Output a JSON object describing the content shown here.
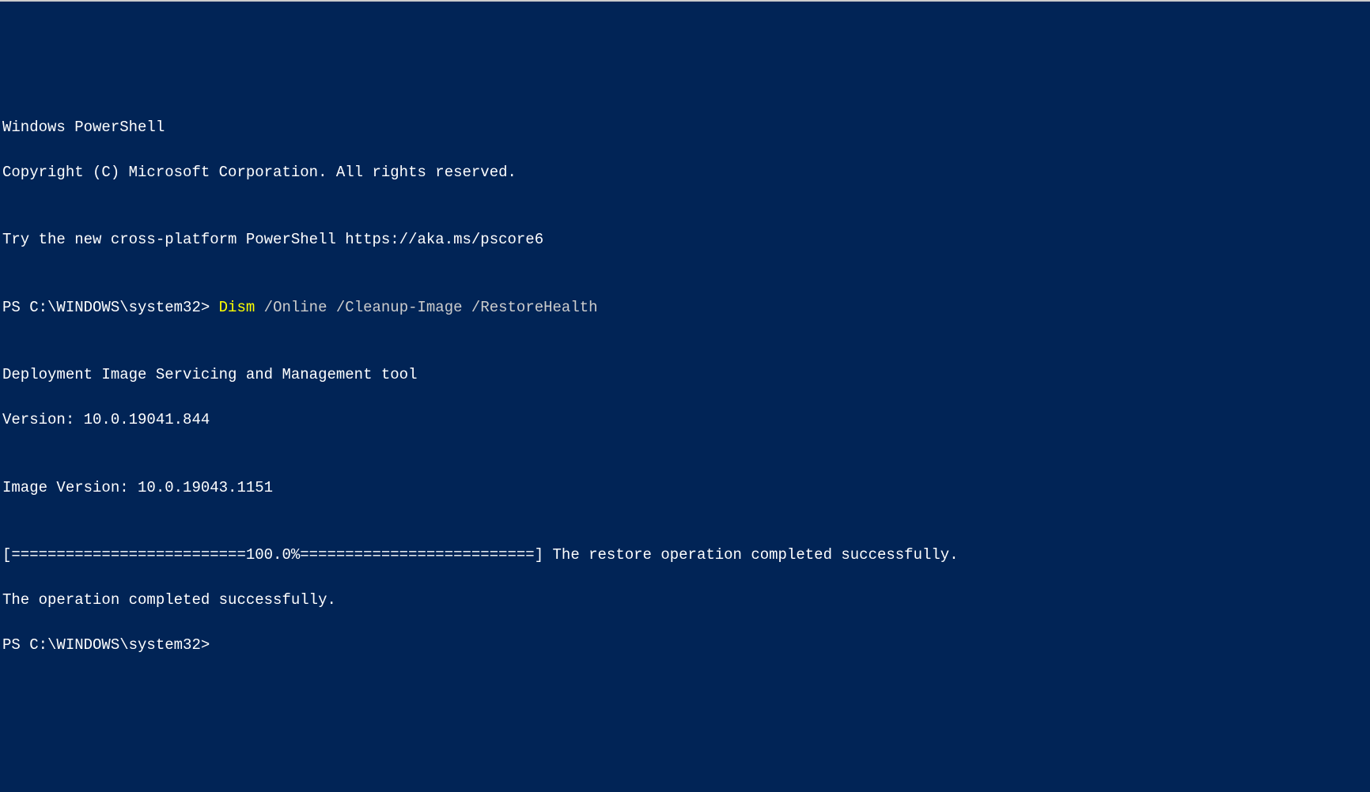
{
  "header": {
    "title": "Windows PowerShell",
    "copyright": "Copyright (C) Microsoft Corporation. All rights reserved.",
    "tryMessage": "Try the new cross-platform PowerShell https://aka.ms/pscore6"
  },
  "prompt1": {
    "prefix": "PS C:\\WINDOWS\\system32> ",
    "cmdName": "Dism ",
    "cmdArgs": "/Online /Cleanup-Image /RestoreHealth"
  },
  "dism": {
    "toolName": "Deployment Image Servicing and Management tool",
    "version": "Version: 10.0.19041.844",
    "imageVersion": "Image Version: 10.0.19043.1151",
    "progressLine": "[==========================100.0%==========================] The restore operation completed successfully.",
    "completed": "The operation completed successfully."
  },
  "prompt2": {
    "prefix": "PS C:\\WINDOWS\\system32>"
  },
  "blank": ""
}
